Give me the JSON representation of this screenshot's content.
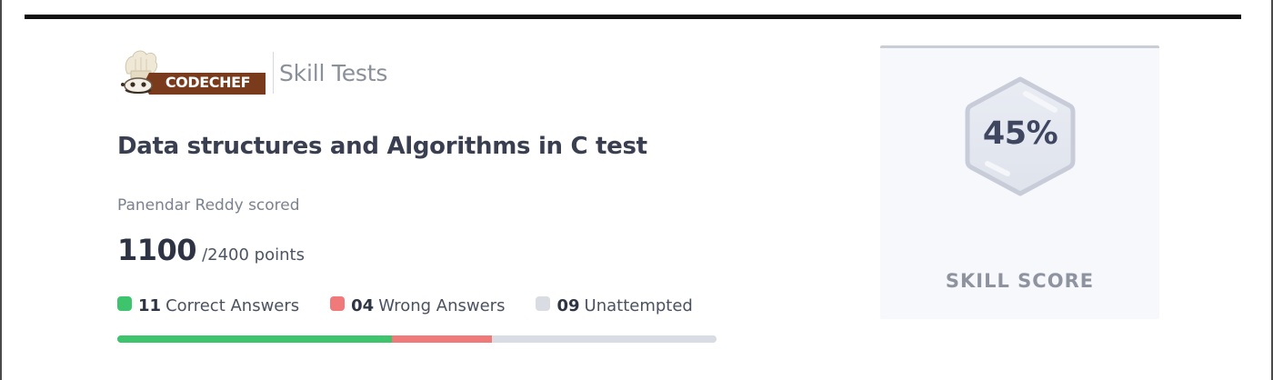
{
  "brand": {
    "logo_text": "CODECHEF",
    "product": "Skill Tests",
    "colors": {
      "badge": "#7a3b1d",
      "badge_dark": "#5b2a14"
    }
  },
  "test": {
    "title": "Data structures and Algorithms in C test",
    "scored_by": "Panendar Reddy scored",
    "score": "1100",
    "total": "/2400 points"
  },
  "answers": [
    {
      "count": "11",
      "label": "Correct Answers",
      "color": "#3ec46d",
      "fraction": 0.458
    },
    {
      "count": "04",
      "label": "Wrong Answers",
      "color": "#f07a7a",
      "fraction": 0.167
    },
    {
      "count": "09",
      "label": "Unattempted",
      "color": "#d9dce3",
      "fraction": 0.375
    }
  ],
  "skill": {
    "percent": "45%",
    "label": "SKILL SCORE",
    "icon": "hexagon-badge-icon"
  }
}
